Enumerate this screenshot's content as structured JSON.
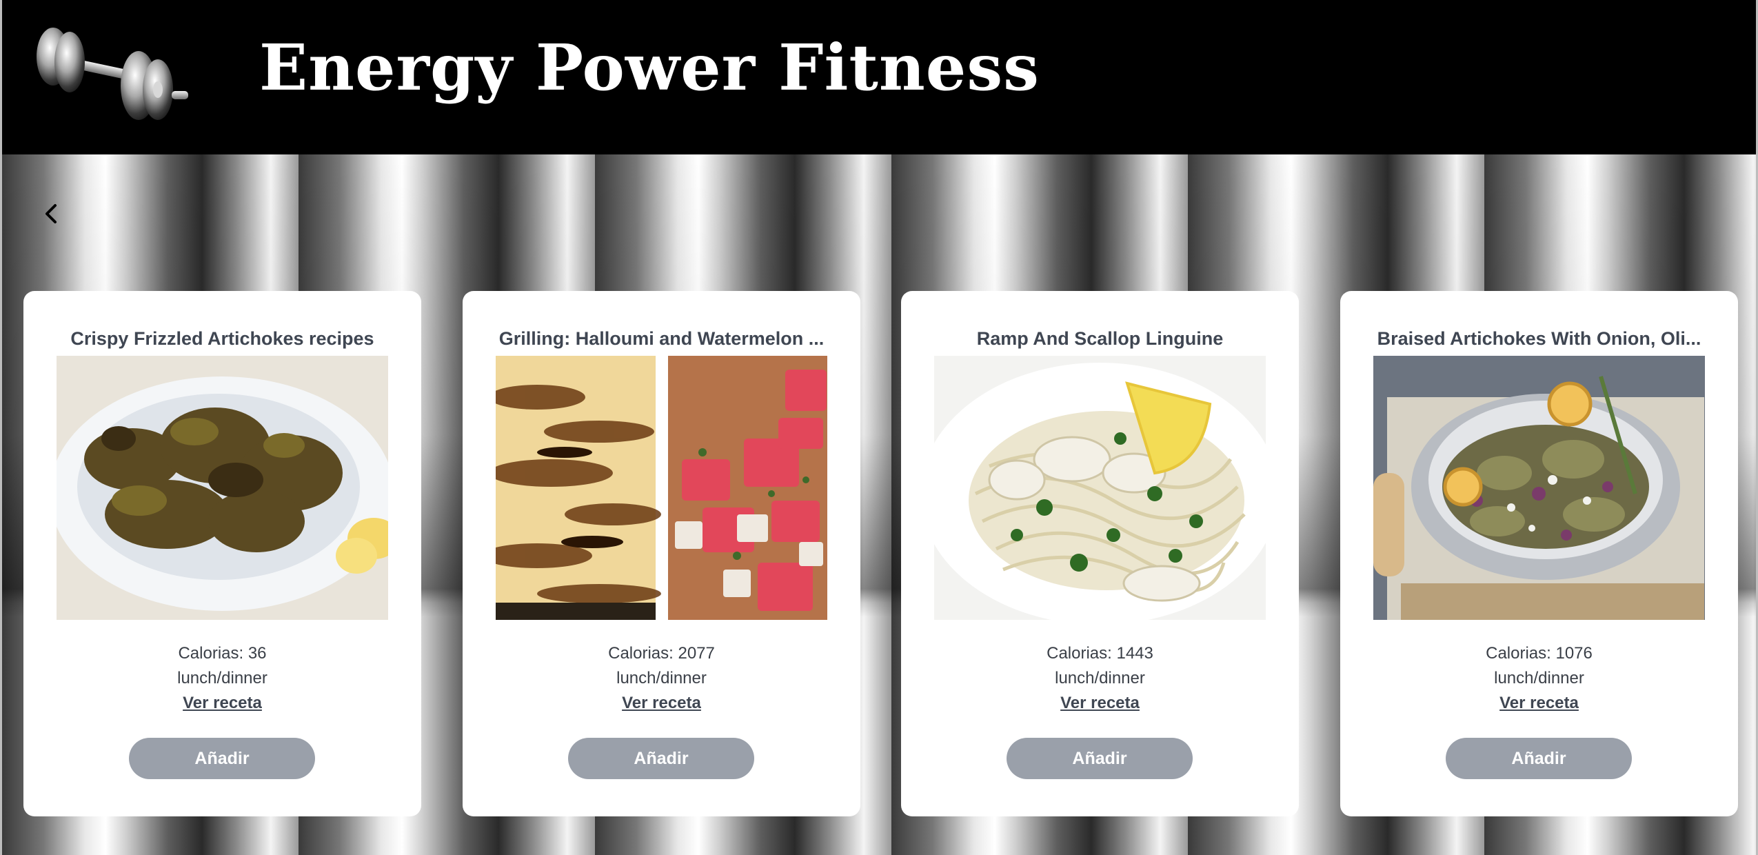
{
  "header": {
    "title": "Energy Power Fitness"
  },
  "nav": {
    "back_icon": "chevron-left-icon"
  },
  "cards": [
    {
      "title": "Crispy Frizzled Artichokes recipes",
      "calories": "Calorias: 36",
      "meal": "lunch/dinner",
      "recipe_link": "Ver receta",
      "add_label": "Añadir"
    },
    {
      "title": "Grilling: Halloumi and Watermelon ...",
      "calories": "Calorias: 2077",
      "meal": "lunch/dinner",
      "recipe_link": "Ver receta",
      "add_label": "Añadir"
    },
    {
      "title": "Ramp And Scallop Linguine",
      "calories": "Calorias: 1443",
      "meal": "lunch/dinner",
      "recipe_link": "Ver receta",
      "add_label": "Añadir"
    },
    {
      "title": "Braised Artichokes With Onion, Oli...",
      "calories": "Calorias: 1076",
      "meal": "lunch/dinner",
      "recipe_link": "Ver receta",
      "add_label": "Añadir"
    }
  ],
  "colors": {
    "header_bg": "#000000",
    "card_bg": "#ffffff",
    "button_bg": "#9aa0aa",
    "text": "#3f4652"
  }
}
